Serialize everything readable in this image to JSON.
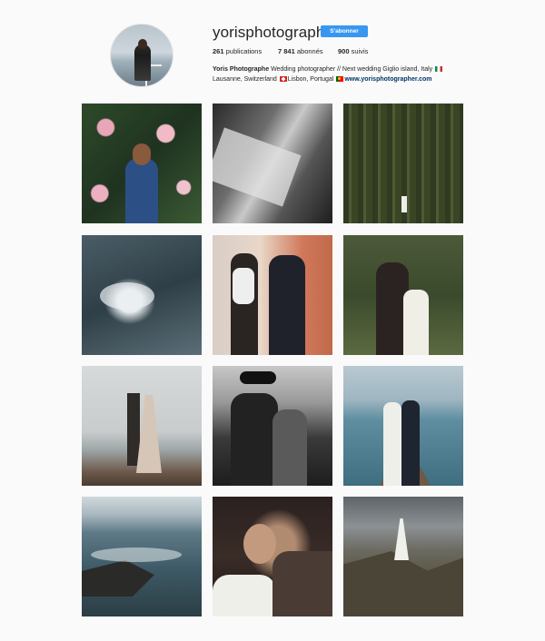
{
  "profile": {
    "username": "yorisphotographer",
    "follow_label": "S'abonner",
    "stats": [
      {
        "value": "261",
        "label": "publications"
      },
      {
        "value": "7 841",
        "label": "abonnés"
      },
      {
        "value": "900",
        "label": "suivis"
      }
    ],
    "bio": {
      "name": "Yoris Photographe",
      "line1": "Wedding photographer // Next wedding Giglio island, Italy",
      "line2_a": "Lausanne, Switzerland",
      "line2_b": "Lisbon, Portugal",
      "website": "www.yorisphotographer.com"
    }
  },
  "posts": [
    {
      "icon": "photo-man-flowers"
    },
    {
      "icon": "photo-bw-embrace"
    },
    {
      "icon": "photo-forest-couple"
    },
    {
      "icon": "photo-sea-wave"
    },
    {
      "icon": "photo-couple-smoke"
    },
    {
      "icon": "photo-forest-kiss"
    },
    {
      "icon": "photo-beach-couple"
    },
    {
      "icon": "photo-bw-couple-hat"
    },
    {
      "icon": "photo-jetty-couple"
    },
    {
      "icon": "photo-rocky-coast"
    },
    {
      "icon": "photo-kiss-portrait"
    },
    {
      "icon": "photo-cliff-bride"
    }
  ],
  "colors": {
    "follow_button": "#3897f0",
    "link": "#003569",
    "background": "#fafafa"
  }
}
